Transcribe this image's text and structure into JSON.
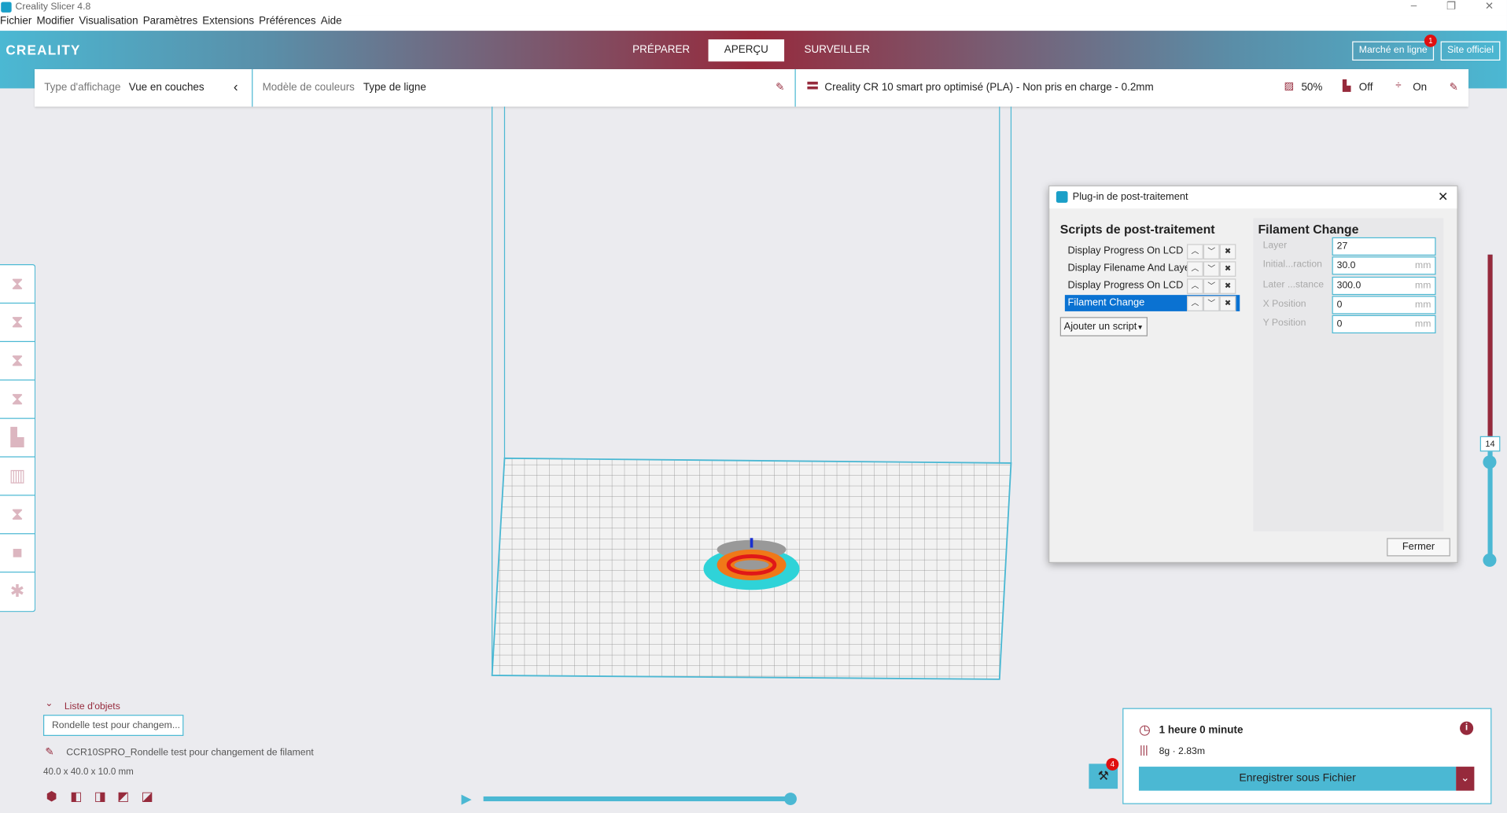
{
  "window": {
    "title": "Creality Slicer 4.8"
  },
  "menu": [
    "Fichier",
    "Modifier",
    "Visualisation",
    "Paramètres",
    "Extensions",
    "Préférences",
    "Aide"
  ],
  "header": {
    "logo": "CREALITY",
    "tabs": [
      "PRÉPARER",
      "APERÇU",
      "SURVEILLER"
    ],
    "active_tab": "APERÇU",
    "marketplace": "Marché en ligne",
    "marketplace_badge": "1",
    "site": "Site officiel"
  },
  "toolbar": {
    "view_type_label": "Type d'affichage",
    "view_type_value": "Vue en couches",
    "color_scheme_label": "Modèle de couleurs",
    "color_scheme_value": "Type de ligne",
    "profile": "Creality CR 10 smart pro optimisé (PLA) - Non pris en charge - 0.2mm",
    "infill": "50%",
    "support": "Off",
    "adhesion": "On"
  },
  "left_tools": [
    "scale-tool-icon",
    "support-tool-icon",
    "mirror-tool-icon",
    "per-model-settings-icon",
    "support-blocker-icon",
    "tree-support-icon",
    "brim-icon",
    "custom-support-icon",
    "multiply-icon"
  ],
  "dialog": {
    "title": "Plug-in de post-traitement",
    "scripts_heading": "Scripts de post-traitement",
    "scripts": [
      "Display Progress On LCD",
      "Display Filename And Layer",
      "Display Progress On LCD",
      "Filament Change"
    ],
    "selected_index": 3,
    "add_script": "Ajouter un script",
    "settings_heading": "Filament Change",
    "fields": [
      {
        "label": "Layer",
        "value": "27",
        "unit": ""
      },
      {
        "label": "Initial...raction",
        "value": "30.0",
        "unit": "mm"
      },
      {
        "label": "Later ...stance",
        "value": "300.0",
        "unit": "mm"
      },
      {
        "label": "X Position",
        "value": "0",
        "unit": "mm"
      },
      {
        "label": "Y Position",
        "value": "0",
        "unit": "mm"
      }
    ],
    "close": "Fermer"
  },
  "layer_slider": {
    "current_layer": "14"
  },
  "objects": {
    "header": "Liste d'objets",
    "item": "Rondelle test pour changem...",
    "job_name": "CCR10SPRO_Rondelle test pour changement de filament",
    "dimensions": "40.0 x 40.0 x 10.0 mm"
  },
  "simulation": {
    "progress": 1.0
  },
  "print": {
    "time": "1 heure 0 minute",
    "material": "8g · 2.83m",
    "save": "Enregistrer sous Fichier",
    "tools_badge": "4"
  },
  "colors": {
    "accent": "#4bb8d3",
    "brand": "#962a3c",
    "selection": "#0a72d2"
  }
}
